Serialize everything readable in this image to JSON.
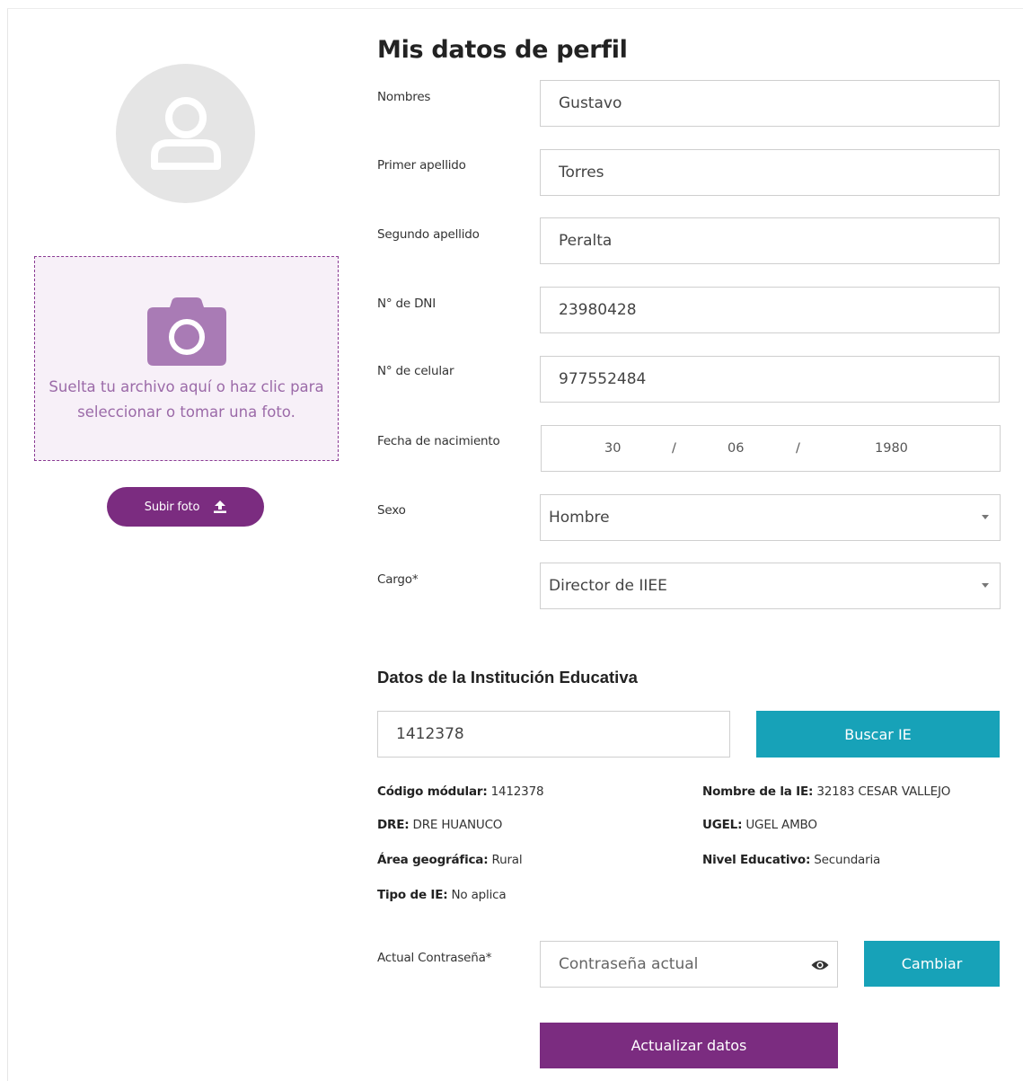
{
  "profile": {
    "title": "Mis datos de perfil",
    "dropzone_text": "Suelta tu archivo aquí o haz clic para seleccionar o tomar una foto.",
    "upload_label": "Subir foto"
  },
  "form": {
    "nombres": {
      "label": "Nombres",
      "value": "Gustavo"
    },
    "primer_apellido": {
      "label": "Primer apellido",
      "value": "Torres"
    },
    "segundo_apellido": {
      "label": "Segundo apellido",
      "value": "Peralta"
    },
    "dni": {
      "label": "N° de DNI",
      "value": "23980428"
    },
    "celular": {
      "label": "N° de celular",
      "value": "977552484"
    },
    "fecha": {
      "label": "Fecha de nacimiento",
      "day": "30",
      "month": "06",
      "year": "1980",
      "sep": "/"
    },
    "sexo": {
      "label": "Sexo",
      "value": "Hombre"
    },
    "cargo": {
      "label": "Cargo*",
      "value": "Director de IIEE"
    }
  },
  "institucion": {
    "title": "Datos de la Institución Educativa",
    "search_value": "1412378",
    "search_button": "Buscar IE",
    "codigo": {
      "label": "Código módular:",
      "value": "1412378"
    },
    "nombre": {
      "label": "Nombre de la IE:",
      "value": "32183 CESAR VALLEJO"
    },
    "dre": {
      "label": "DRE:",
      "value": "DRE HUANUCO"
    },
    "ugel": {
      "label": "UGEL:",
      "value": "UGEL AMBO"
    },
    "area": {
      "label": "Área geográfica:",
      "value": "Rural"
    },
    "nivel": {
      "label": "Nivel Educativo:",
      "value": "Secundaria"
    },
    "tipo": {
      "label": "Tipo de IE:",
      "value": "No aplica"
    }
  },
  "password": {
    "label": "Actual Contraseña*",
    "placeholder": "Contraseña actual",
    "change_button": "Cambiar"
  },
  "submit_label": "Actualizar datos",
  "colors": {
    "primary": "#7b2c80",
    "accent": "#17a2b8",
    "dropzone_bg": "#f7f0f8"
  },
  "icons": {
    "avatar": "user-icon",
    "camera": "camera-icon",
    "upload": "upload-icon",
    "eye": "eye-icon",
    "caret": "chevron-down-icon"
  }
}
